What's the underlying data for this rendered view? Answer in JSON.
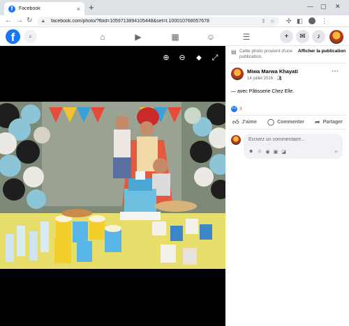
{
  "browser": {
    "tab_title": "Facebook",
    "tab_close": "×",
    "new_tab": "+",
    "url": "facebook.com/photo/?fbid=1059713894105448&set=t.100010768057678",
    "minimize": "—",
    "maximize": "▢",
    "close": "✕"
  },
  "fb": {
    "logo": "f"
  },
  "sidebar": {
    "notice_text": "Cette photo provient d'une publication.",
    "view_post": "Afficher la publication",
    "author": "Miwa Marwa Khayati",
    "date": "14 juillet 2016 · ",
    "caption": "— avec Pâtisserie Chez Elle.",
    "reaction_count": "3",
    "actions": {
      "like": "J'aime",
      "comment": "Commenter",
      "share": "Partager"
    },
    "comment_placeholder": "Écrivez un commentaire..."
  },
  "icons": {
    "browser": [
      "back-icon",
      "forward-icon",
      "reload-icon",
      "lock-icon",
      "share-icon",
      "star-icon",
      "extensions-icon",
      "sidepanel-icon",
      "profile-icon",
      "kebab-icon"
    ],
    "facebook_nav": [
      "home-icon",
      "video-icon",
      "marketplace-icon",
      "groups-icon",
      "menu-icon"
    ],
    "facebook_actions": [
      "plus-icon",
      "messenger-icon",
      "bell-icon"
    ],
    "viewer": [
      "zoom-in-icon",
      "zoom-out-icon",
      "tag-icon",
      "fullscreen-icon"
    ]
  },
  "colors": {
    "facebook_blue": "#1877f2",
    "viewer_bg": "#000000",
    "secondary_text": "#65676b"
  }
}
